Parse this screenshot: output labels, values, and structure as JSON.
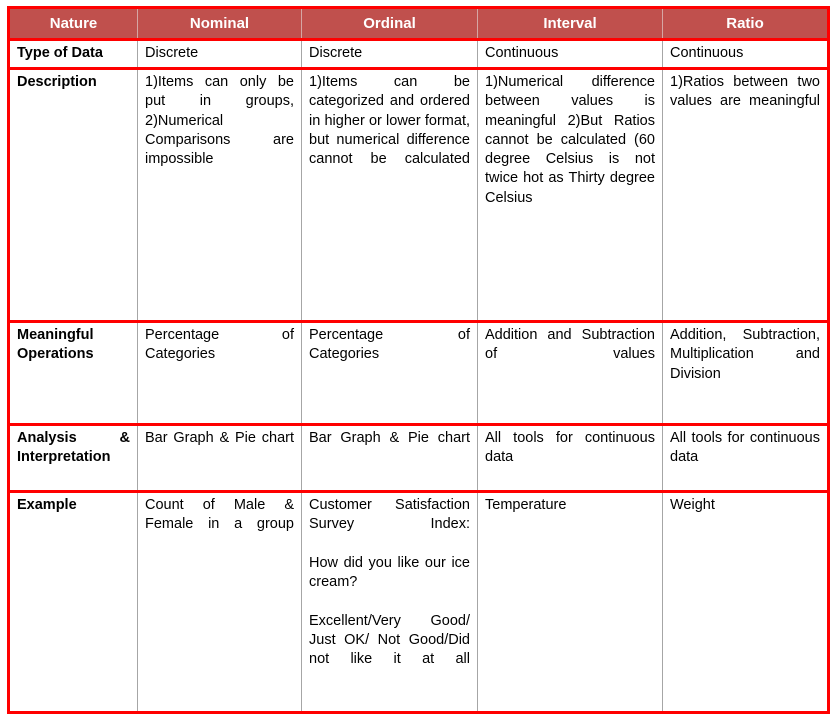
{
  "table": {
    "columns": [
      "Nature",
      "Nominal",
      "Ordinal",
      "Interval",
      "Ratio"
    ],
    "rows": [
      {
        "label": "Type of Data",
        "cells": [
          "Discrete",
          "Discrete",
          "Continuous",
          "Continuous"
        ]
      },
      {
        "label": "Description",
        "cells": [
          "1)Items can only be put in groups, 2)Numerical Comparisons are impossible",
          "1)Items can be categorized and ordered in higher or lower format, but numerical difference cannot be calculated",
          "1)Numerical difference between values is meaningful 2)But Ratios cannot be calculated (60 degree Celsius is not twice hot as Thirty degree Celsius",
          "1)Ratios between two values are meaningful"
        ]
      },
      {
        "label": "Meaningful Operations",
        "cells": [
          "Percentage of Categories",
          "Percentage of Categories",
          "Addition and Subtraction of values",
          "Addition, Subtraction, Multiplication and Division"
        ]
      },
      {
        "label": "Analysis & Interpretation",
        "cells": [
          "Bar Graph & Pie chart",
          "Bar Graph & Pie chart",
          "All tools for continuous data",
          "All tools for continuous data"
        ]
      },
      {
        "label": "Example",
        "cells": [
          "Count of Male & Female in a group",
          "Customer Satisfaction Survey Index:\nHow did you like our ice cream?\nExcellent/Very Good/ Just OK/ Not Good/Did not like it at all",
          "Temperature",
          "Weight"
        ]
      }
    ]
  },
  "style": {
    "header_fill": "#C0504D",
    "header_text": "#FFFFFF",
    "border_accent": "#FF0000",
    "grid_line": "#A6A6A6",
    "body_text": "#000000",
    "page_background": "#FFFFFF"
  }
}
